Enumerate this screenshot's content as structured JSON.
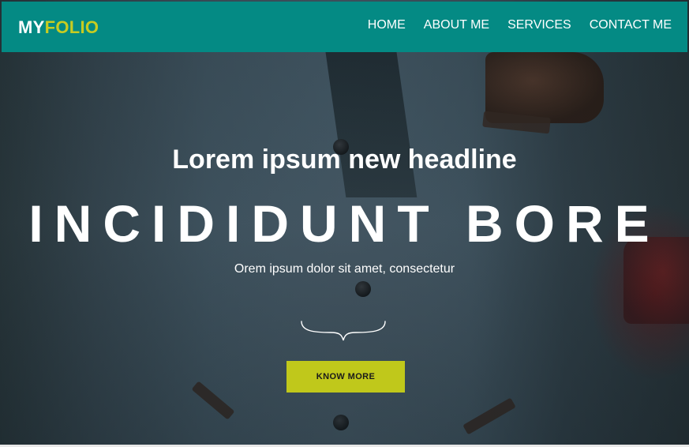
{
  "brand": {
    "logo_part1": "MY",
    "logo_part2": "FOLIO"
  },
  "nav": {
    "items": [
      {
        "label": "HOME"
      },
      {
        "label": "ABOUT ME"
      },
      {
        "label": "SERVICES"
      },
      {
        "label": "CONTACT ME"
      }
    ]
  },
  "hero": {
    "headline": "Lorem ipsum new headline",
    "title": "INCIDIDUNT BORE",
    "subtitle": "Orem ipsum dolor sit amet, consectetur",
    "cta_label": "KNOW MORE"
  },
  "colors": {
    "navbar": "#048a84",
    "accent": "#c7cc21",
    "cta": "#c0c81b",
    "text": "#ffffff"
  },
  "icons": {
    "divider": "curly-brace-divider-icon"
  }
}
